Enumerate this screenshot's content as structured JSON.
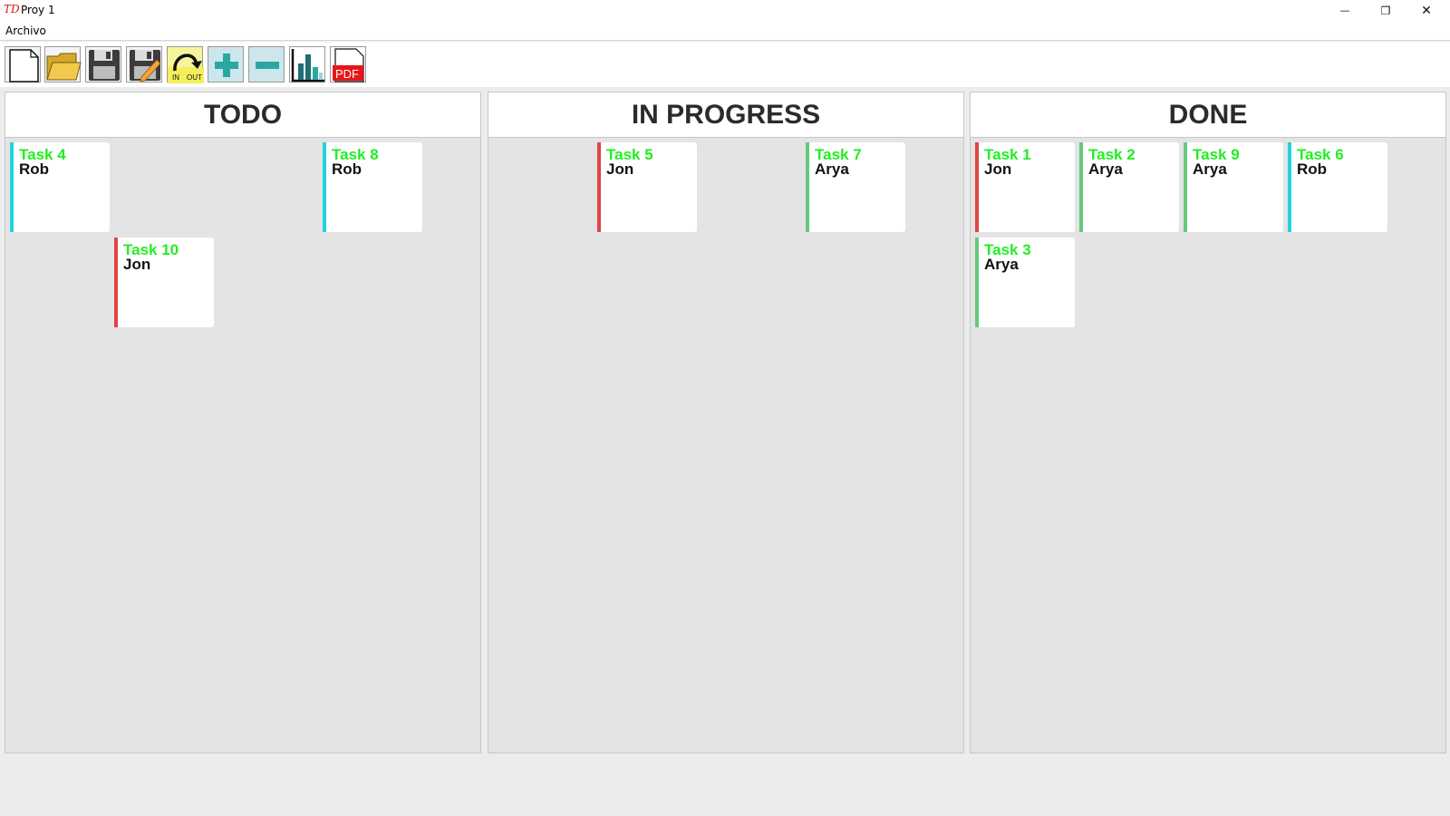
{
  "window": {
    "logo_text": "TD",
    "title": "Proy 1",
    "minimize_glyph": "—",
    "restore_glyph": "❐",
    "close_glyph": "✕"
  },
  "menu": {
    "items": [
      "Archivo"
    ]
  },
  "toolbar": {
    "buttons": [
      {
        "name": "new-document",
        "icon": "blank-page-icon"
      },
      {
        "name": "open-folder",
        "icon": "folder-icon"
      },
      {
        "name": "save",
        "icon": "floppy-disk-icon"
      },
      {
        "name": "save-as",
        "icon": "floppy-pencil-icon"
      },
      {
        "name": "import-export",
        "icon": "in-out-arrow-icon",
        "label_in": "IN",
        "label_out": "OUT"
      },
      {
        "name": "add-task",
        "icon": "plus-icon"
      },
      {
        "name": "remove-task",
        "icon": "minus-icon"
      },
      {
        "name": "statistics",
        "icon": "bar-chart-icon"
      },
      {
        "name": "export-pdf",
        "icon": "pdf-icon",
        "label": "PDF"
      }
    ]
  },
  "colors": {
    "task_title": "#22ee22",
    "owner_text": "#111111",
    "accent_rob": "#22d3dd",
    "accent_jon": "#e04444",
    "accent_arya": "#66c97a",
    "pdf_red": "#e8151b",
    "teal": "#2aa7a0"
  },
  "columns": [
    {
      "title": "TODO",
      "cards": [
        {
          "title": "Task 4",
          "owner": "Rob",
          "accent": "#22d3dd"
        },
        {
          "title": "Task 8",
          "owner": "Rob",
          "accent": "#22d3dd"
        },
        {
          "title": "Task 10",
          "owner": "Jon",
          "accent": "#e04444"
        }
      ]
    },
    {
      "title": "IN PROGRESS",
      "cards": [
        {
          "title": "Task 5",
          "owner": "Jon",
          "accent": "#e04444"
        },
        {
          "title": "Task 7",
          "owner": "Arya",
          "accent": "#66c97a"
        }
      ]
    },
    {
      "title": "DONE",
      "cards": [
        {
          "title": "Task 1",
          "owner": "Jon",
          "accent": "#e04444"
        },
        {
          "title": "Task 2",
          "owner": "Arya",
          "accent": "#66c97a"
        },
        {
          "title": "Task 9",
          "owner": "Arya",
          "accent": "#66c97a"
        },
        {
          "title": "Task 6",
          "owner": "Rob",
          "accent": "#22d3dd"
        },
        {
          "title": "Task 3",
          "owner": "Arya",
          "accent": "#66c97a"
        }
      ]
    }
  ]
}
